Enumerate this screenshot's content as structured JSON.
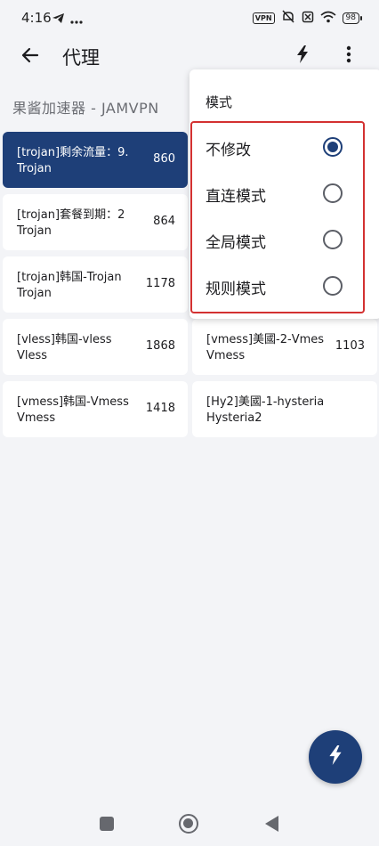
{
  "status_bar": {
    "time": "4:16",
    "vpn_label": "VPN",
    "battery": "98"
  },
  "appbar": {
    "title": "代理"
  },
  "group": {
    "title": "果酱加速器 - JAMVPN"
  },
  "proxies": [
    {
      "name": "[trojan]剩余流量：9.",
      "type": "Trojan",
      "ping": "860",
      "selected": true
    },
    {
      "name": "[trojan]套餐到期：2",
      "type": "Trojan",
      "ping": "864",
      "selected": false
    },
    {
      "name": "[trojan]韩国-Trojan",
      "type": "Trojan",
      "ping": "1178",
      "selected": false
    },
    {
      "name": "[vless]韩国-vless",
      "type": "Vless",
      "ping": "1868",
      "selected": false
    },
    {
      "name": "[vmess]韩国-Vmess",
      "type": "Vmess",
      "ping": "1418",
      "selected": false
    },
    {
      "name": "[vmess]美國-2-Vmes",
      "type": "Vmess",
      "ping": "1103",
      "selected": false
    },
    {
      "name": "[Hy2]美國-1-hysteria",
      "type": "Hysteria2",
      "ping": "",
      "selected": false
    }
  ],
  "mode_menu": {
    "header": "模式",
    "items": [
      {
        "label": "不修改",
        "checked": true
      },
      {
        "label": "直连模式",
        "checked": false
      },
      {
        "label": "全局模式",
        "checked": false
      },
      {
        "label": "规则模式",
        "checked": false
      }
    ]
  },
  "colors": {
    "accent": "#1e3f78",
    "highlight_border": "#d33131"
  }
}
